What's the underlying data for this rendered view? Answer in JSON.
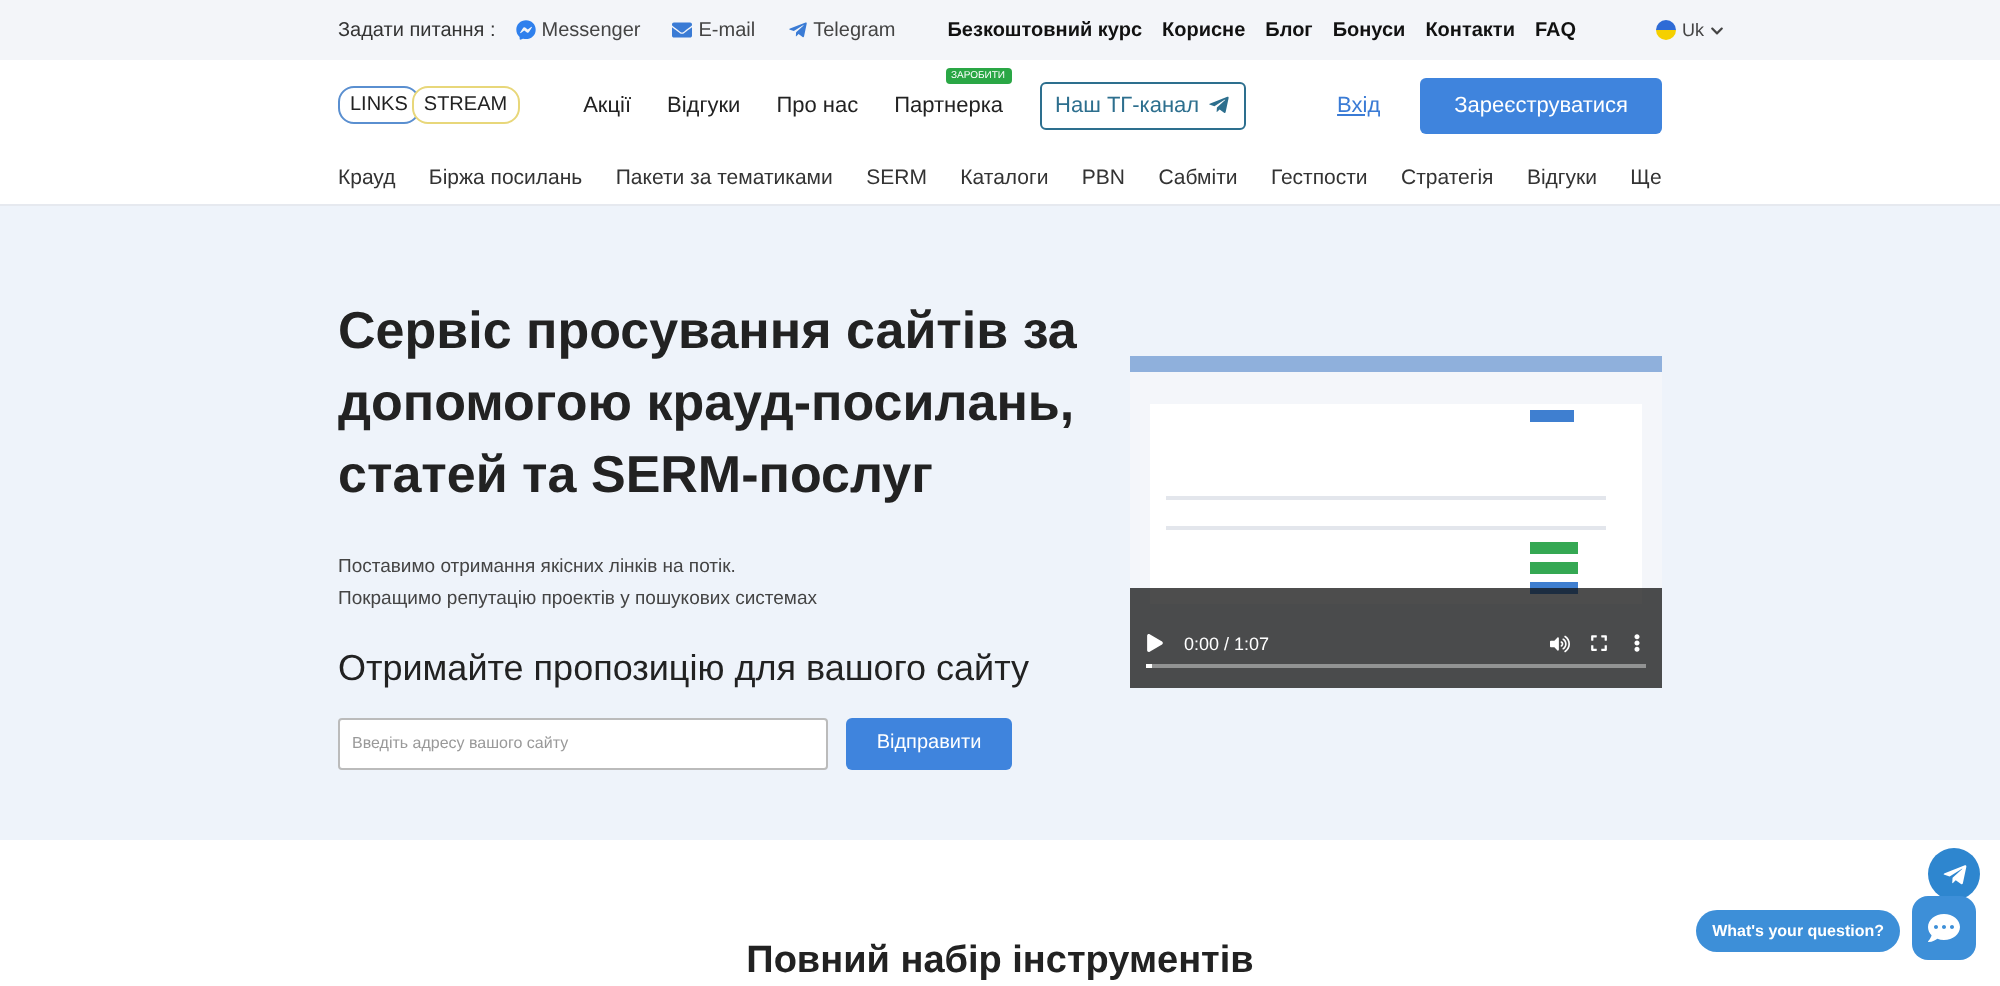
{
  "top_bar": {
    "label": "Задати питання :",
    "contacts": [
      {
        "kind": "messenger",
        "label": "Messenger"
      },
      {
        "kind": "email",
        "label": "E-mail"
      },
      {
        "kind": "telegram",
        "label": "Telegram"
      }
    ],
    "links": [
      "Безкоштовний курс",
      "Корисне",
      "Блог",
      "Бонуси",
      "Контакти",
      "FAQ"
    ],
    "language": "Uk"
  },
  "header": {
    "logo": [
      "LINKS",
      "STREAM"
    ],
    "nav": [
      {
        "label": "Акції"
      },
      {
        "label": "Відгуки"
      },
      {
        "label": "Про нас"
      },
      {
        "label": "Партнерка",
        "badge": "ЗАРОБИТИ"
      }
    ],
    "tg_button": "Наш ТГ-канал",
    "login": "Вхід",
    "register": "Зареєструватися"
  },
  "menu": [
    "Крауд",
    "Біржа посилань",
    "Пакети за тематиками",
    "SERM",
    "Каталоги",
    "PBN",
    "Сабміти",
    "Гестпости",
    "Стратегія",
    "Відгуки",
    "Ще"
  ],
  "hero": {
    "title": "Сервіс просування сайтів за допомогою крауд-посилань, статей та SERM-послуг",
    "subtitle": [
      "Поставимо отримання якісних лінків на потік.",
      "Покращимо репутацію проектів у пошукових системах"
    ],
    "offer": "Отримайте пропозицію для вашого сайту",
    "field": {
      "placeholder": "Введіть адресу вашого сайту"
    },
    "submit": "Відправити",
    "video": {
      "kind": "picture",
      "time": "0:00 / 1:07",
      "level": 0.01
    }
  },
  "section": {
    "title": "Повний набір інструментів"
  },
  "chat": {
    "bubble": "What's your question?"
  }
}
